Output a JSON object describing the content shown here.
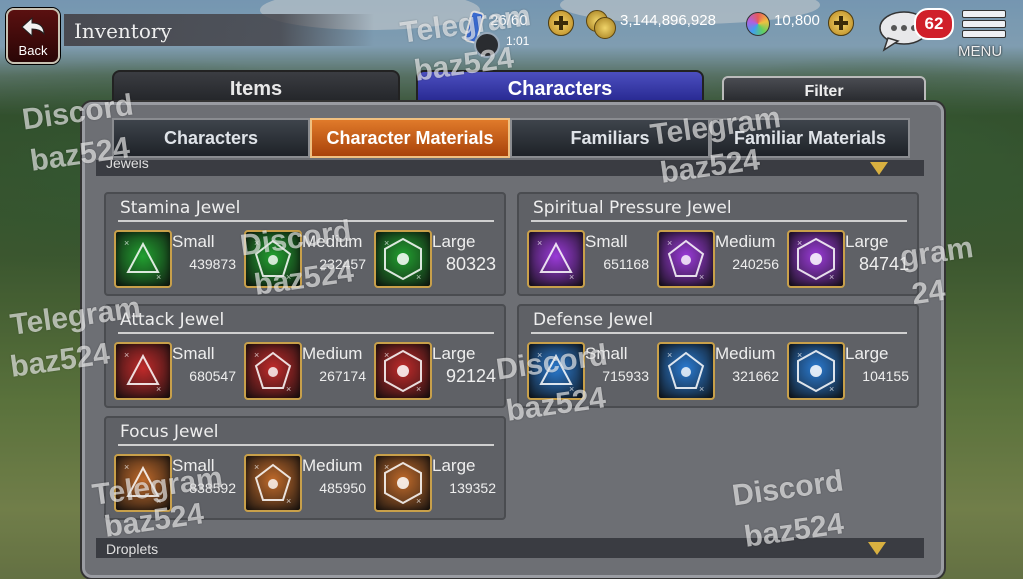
{
  "header": {
    "back_label": "Back",
    "title": "Inventory",
    "stamina": "26/60",
    "stamina_timer": "1:01",
    "gold": "3,144,896,928",
    "gems": "10,800",
    "message_count": "62",
    "menu_label": "MENU"
  },
  "tabs": {
    "items": "Items",
    "characters": "Characters",
    "filter": "Filter"
  },
  "sub_tabs": [
    "Characters",
    "Character Materials",
    "Familiars",
    "Familiar Materials"
  ],
  "sections": {
    "jewels": "Jewels",
    "droplets": "Droplets"
  },
  "jewel_groups": [
    {
      "name": "Stamina Jewel",
      "color": "#22a030",
      "items": [
        {
          "size": "Small",
          "count": "439873"
        },
        {
          "size": "Medium",
          "count": "232457"
        },
        {
          "size": "Large",
          "count": "80323"
        }
      ]
    },
    {
      "name": "Spiritual Pressure Jewel",
      "color": "#9a3ad8",
      "items": [
        {
          "size": "Small",
          "count": "651168"
        },
        {
          "size": "Medium",
          "count": "240256"
        },
        {
          "size": "Large",
          "count": "84741"
        }
      ]
    },
    {
      "name": "Attack Jewel",
      "color": "#c02a2a",
      "items": [
        {
          "size": "Small",
          "count": "680547"
        },
        {
          "size": "Medium",
          "count": "267174"
        },
        {
          "size": "Large",
          "count": "92124"
        }
      ]
    },
    {
      "name": "Defense Jewel",
      "color": "#2a7ad0",
      "items": [
        {
          "size": "Small",
          "count": "715933"
        },
        {
          "size": "Medium",
          "count": "321662"
        },
        {
          "size": "Large",
          "count": "104155"
        }
      ]
    },
    {
      "name": "Focus Jewel",
      "color": "#c06a2a",
      "items": [
        {
          "size": "Small",
          "count": "838592"
        },
        {
          "size": "Medium",
          "count": "485950"
        },
        {
          "size": "Large",
          "count": "139352"
        }
      ]
    }
  ],
  "watermarks": [
    "Telegram",
    "baz524",
    "Discord",
    "baz524",
    "Telegram",
    "baz524",
    "Discord",
    "baz524",
    "gram",
    "24",
    "Telegram",
    "baz524",
    "Discord",
    "baz524",
    "Telegram",
    "baz524",
    "Discord",
    "baz524"
  ]
}
